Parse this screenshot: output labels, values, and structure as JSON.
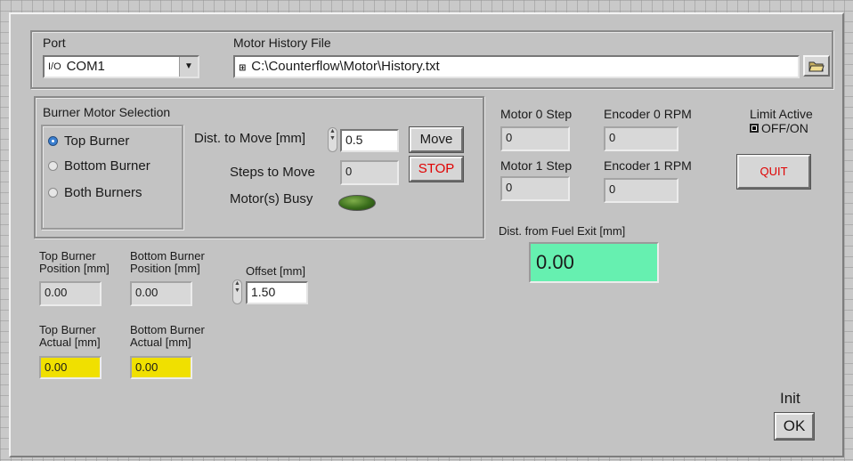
{
  "port": {
    "label": "Port",
    "value": "COM1",
    "io_icon": "io-icon",
    "dropdown_icon": "chevron-down-icon"
  },
  "history": {
    "label": "Motor History File",
    "path": "C:\\Counterflow\\Motor\\History.txt",
    "path_icon": "path-icon",
    "browse_icon": "folder-icon"
  },
  "selection": {
    "title": "Burner Motor Selection",
    "options": [
      {
        "label": "Top Burner",
        "selected": true
      },
      {
        "label": "Bottom Burner",
        "selected": false
      },
      {
        "label": "Both Burners",
        "selected": false
      }
    ],
    "dist_label": "Dist. to Move [mm]",
    "dist_value": "0.5",
    "steps_label": "Steps to Move",
    "steps_value": "0",
    "busy_label": "Motor(s) Busy",
    "move_label": "Move",
    "stop_label": "STOP"
  },
  "motors": {
    "m0_label": "Motor 0 Step",
    "m0_value": "0",
    "m1_label": "Motor 1 Step",
    "m1_value": "0",
    "e0_label": "Encoder 0 RPM",
    "e0_value": "0",
    "e1_label": "Encoder 1 RPM",
    "e1_value": "0"
  },
  "limit": {
    "label": "Limit Active",
    "toggle_label": "OFF/ON"
  },
  "quit_label": "QUIT",
  "fuel": {
    "label": "Dist. from Fuel Exit [mm]",
    "value": "0.00"
  },
  "positions": {
    "top_pos_label": "Top Burner Position [mm]",
    "top_pos_value": "0.00",
    "bot_pos_label": "Bottom Burner Position [mm]",
    "bot_pos_value": "0.00",
    "offset_label": "Offset [mm]",
    "offset_value": "1.50",
    "top_act_label": "Top Burner Actual [mm]",
    "top_act_value": "0.00",
    "bot_act_label": "Bottom Burner Actual [mm]",
    "bot_act_value": "0.00"
  },
  "init": {
    "label": "Init",
    "ok_label": "OK"
  },
  "colors": {
    "fuel_display": "#66f0b0",
    "actual_indicator": "#f0e000",
    "stop_text": "#e00000",
    "quit_text": "#e00000",
    "radio_selected": "#3a7fd0",
    "led_off": "#3a6e1c"
  }
}
